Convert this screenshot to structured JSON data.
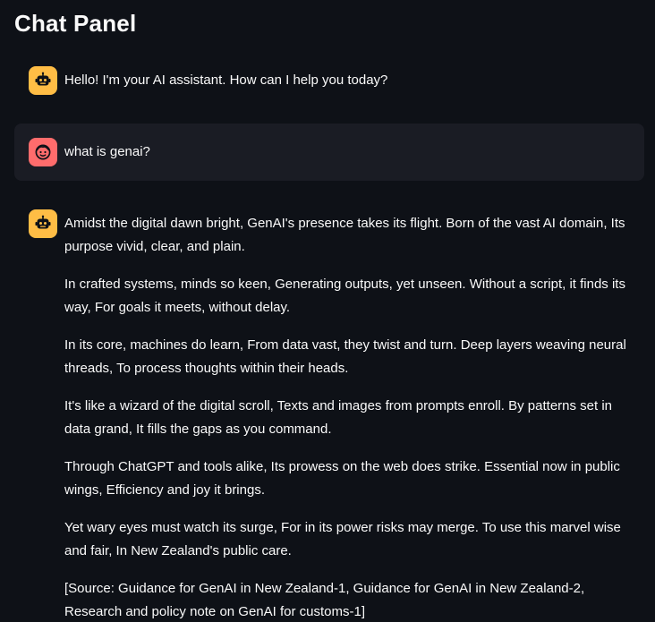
{
  "page": {
    "title": "Chat Panel"
  },
  "messages": [
    {
      "role": "assistant",
      "avatar_icon": "robot-icon",
      "paragraphs": [
        "Hello! I'm your AI assistant. How can I help you today?"
      ]
    },
    {
      "role": "user",
      "avatar_icon": "user-face-icon",
      "paragraphs": [
        "what is genai?"
      ]
    },
    {
      "role": "assistant",
      "avatar_icon": "robot-icon",
      "paragraphs": [
        "Amidst the digital dawn bright, GenAI's presence takes its flight. Born of the vast AI domain, Its purpose vivid, clear, and plain.",
        "In crafted systems, minds so keen, Generating outputs, yet unseen. Without a script, it finds its way, For goals it meets, without delay.",
        "In its core, machines do learn, From data vast, they twist and turn. Deep layers weaving neural threads, To process thoughts within their heads.",
        "It's like a wizard of the digital scroll, Texts and images from prompts enroll. By patterns set in data grand, It fills the gaps as you command.",
        "Through ChatGPT and tools alike, Its prowess on the web does strike. Essential now in public wings, Efficiency and joy it brings.",
        "Yet wary eyes must watch its surge, For in its power risks may merge. To use this marvel wise and fair, In New Zealand's public care.",
        "[Source: Guidance for GenAI in New Zealand-1, Guidance for GenAI in New Zealand-2, Research and policy note on GenAI for customs-1]"
      ]
    }
  ],
  "colors": {
    "background": "#0e1117",
    "user_bubble": "#1a1c24",
    "bot_avatar": "#ffbd45",
    "user_avatar": "#ff6c6c",
    "text": "#fafafa"
  }
}
